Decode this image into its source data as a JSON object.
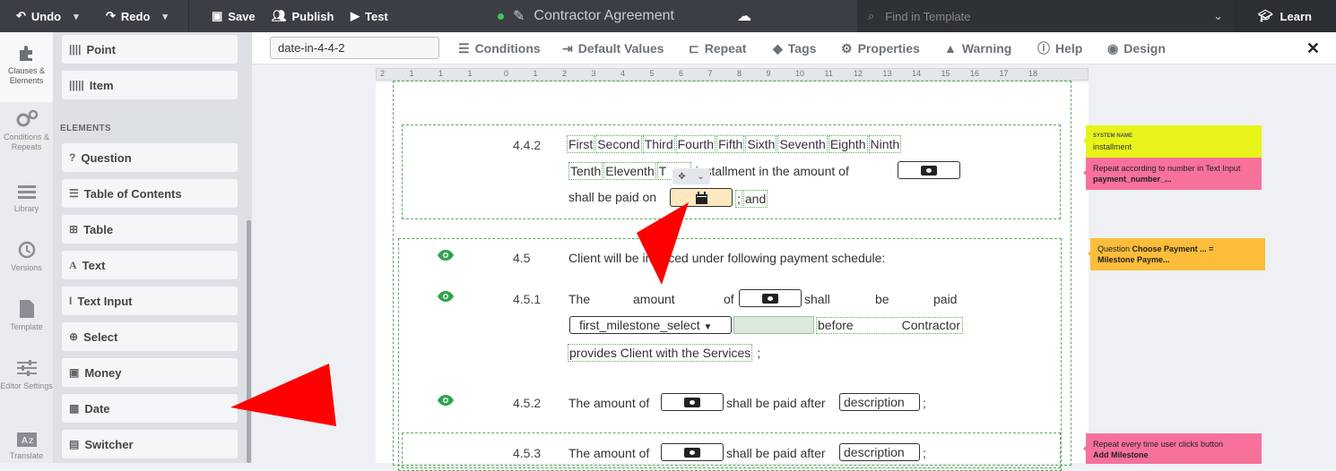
{
  "topbar": {
    "undo": "Undo",
    "redo": "Redo",
    "save": "Save",
    "publish": "Publish",
    "test": "Test",
    "doc_title": "Contractor Agreement",
    "find_placeholder": "Find in Template",
    "learn": "Learn"
  },
  "rail": [
    {
      "label": "Clauses & Elements",
      "icon": "puzzle-icon"
    },
    {
      "label": "Conditions & Repeats",
      "icon": "gears-icon"
    },
    {
      "label": "Library",
      "icon": "library-icon"
    },
    {
      "label": "Versions",
      "icon": "history-icon"
    },
    {
      "label": "Template",
      "icon": "document-icon"
    },
    {
      "label": "Editor Settings",
      "icon": "sliders-icon"
    },
    {
      "label": "Translate",
      "icon": "translate-icon"
    }
  ],
  "elements_panel": {
    "top_items": [
      "Point",
      "Item"
    ],
    "heading": "ELEMENTS",
    "items": [
      "Question",
      "Table of Contents",
      "Table",
      "Text",
      "Text Input",
      "Select",
      "Money",
      "Date",
      "Switcher"
    ]
  },
  "toolbar2": {
    "element_id": "date-in-4-4-2",
    "conditions": "Conditions",
    "default_values": "Default Values",
    "repeat": "Repeat",
    "tags": "Tags",
    "properties": "Properties",
    "warning": "Warning",
    "help": "Help",
    "design": "Design",
    "close": "✕"
  },
  "ruler_ticks": [
    "2",
    "1",
    "1",
    "1",
    "0",
    "1",
    "2",
    "3",
    "4",
    "5",
    "6",
    "7",
    "8",
    "9",
    "10",
    "11",
    "12",
    "13",
    "14",
    "15",
    "16",
    "17",
    "18"
  ],
  "document": {
    "c442": {
      "num": "4.4.2",
      "ordinals_row1": [
        "First",
        "Second",
        "Third",
        "Fourth",
        "Fifth",
        "Sixth",
        "Seventh",
        "Eighth",
        "Ninth"
      ],
      "ordinals_row2": [
        "Tenth",
        "Eleventh",
        "T"
      ],
      "row2_tail": "installment in the amount of",
      "row3_pre": "shall be paid on",
      "row3_sep": ";",
      "row3_and": "and"
    },
    "c45": {
      "num": "4.5",
      "text": "Client will be invoiced under following payment schedule:"
    },
    "c451": {
      "num": "4.5.1",
      "w1": "The",
      "w2": "amount",
      "w3": "of",
      "w4": "shall",
      "w5": "be",
      "w6": "paid",
      "select_value": "first_milestone_select",
      "after_select": "before",
      "contractor": "Contractor",
      "line3": "provides Client with the Services",
      "line3_end": ";"
    },
    "c452": {
      "num": "4.5.2",
      "pre": "The amount of",
      "mid": "shall be paid after",
      "field": "description",
      "end": ";"
    },
    "c453": {
      "num": "4.5.3",
      "pre": "The amount of",
      "mid": "shall be paid after",
      "field": "description",
      "end": ";"
    }
  },
  "notes": {
    "system_label": "SYSTEM NAME",
    "system_value": "installment",
    "repeat_pre": "Repeat according to number in Text Input",
    "repeat_bold": "payment_number_...",
    "question_pre": "Question",
    "question_bold1": "Choose Payment ... =",
    "question_bold2": "Milestone Payme...",
    "repeat2_pre": "Repeat every time user clicks button",
    "repeat2_bold": "Add Milestone"
  },
  "colors": {
    "topbar": "#3b3f45",
    "note_yellow": "#e8f31a",
    "note_pink": "#f7719a",
    "note_orange": "#fbbd3a",
    "arrow_red": "#ff0000",
    "date_fill": "#fde8bf",
    "eye_green": "#2ea44f"
  }
}
